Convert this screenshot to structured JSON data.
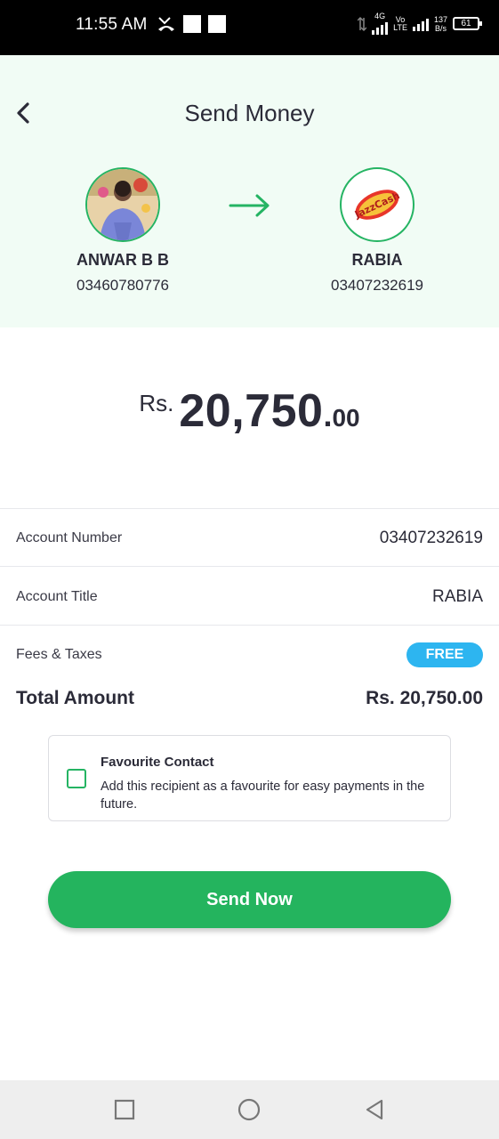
{
  "status_bar": {
    "time": "11:55 AM",
    "network_4g": "4G",
    "network_vo": "Vo",
    "network_lte": "LTE",
    "speed_value": "137",
    "speed_unit": "B/s",
    "battery": "61"
  },
  "header": {
    "title": "Send Money",
    "back_icon": "chevron-left-icon",
    "arrow_icon": "arrow-right-icon",
    "accent_color": "#25b463"
  },
  "sender": {
    "name": "ANWAR B B",
    "phone": "03460780776"
  },
  "receiver": {
    "name": "RABIA",
    "phone": "03407232619",
    "logo_text": "JazzCash"
  },
  "amount": {
    "currency": "Rs.",
    "whole": "20,750",
    "dot": ".",
    "decimal": "00"
  },
  "details": {
    "account_number_label": "Account Number",
    "account_number_value": "03407232619",
    "account_title_label": "Account Title",
    "account_title_value": "RABIA",
    "fees_label": "Fees & Taxes",
    "fees_value": "FREE",
    "total_label": "Total Amount",
    "total_value": "Rs. 20,750.00"
  },
  "favourite": {
    "title": "Favourite Contact",
    "description": "Add this recipient as a favourite for easy payments in the future.",
    "checked": false
  },
  "send_button": {
    "label": "Send Now",
    "color": "#24b45e"
  },
  "nav_bar": {
    "recents_icon": "square-icon",
    "home_icon": "circle-icon",
    "back_icon": "triangle-back-icon"
  }
}
